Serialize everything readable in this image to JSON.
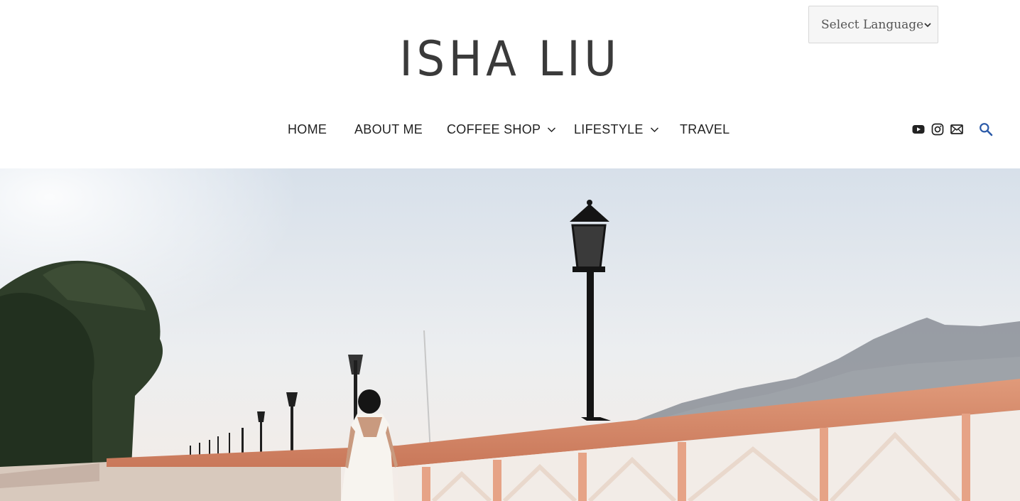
{
  "language": {
    "label": "Select Language"
  },
  "site": {
    "title": "ISHA LIU"
  },
  "nav": {
    "items": [
      {
        "label": "HOME",
        "has_dropdown": false
      },
      {
        "label": "ABOUT ME",
        "has_dropdown": false
      },
      {
        "label": "COFFEE SHOP",
        "has_dropdown": true
      },
      {
        "label": "LIFESTYLE",
        "has_dropdown": true
      },
      {
        "label": "TRAVEL",
        "has_dropdown": false
      }
    ]
  },
  "header_icons": [
    "youtube-icon",
    "instagram-icon",
    "email-icon",
    "search-icon"
  ],
  "colors": {
    "search_icon": "#2b5aa8",
    "text": "#222222",
    "railing": "#d98a6a"
  }
}
